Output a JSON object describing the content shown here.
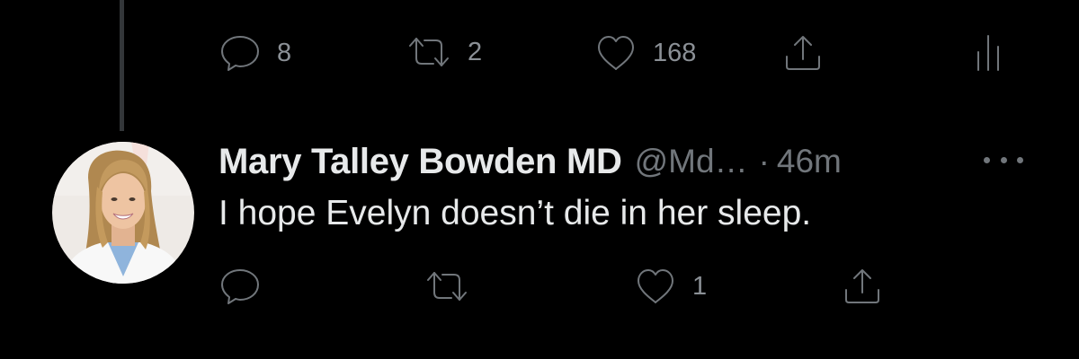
{
  "top_tweet_actions": {
    "reply_count": "8",
    "retweet_count": "2",
    "like_count": "168"
  },
  "reply_tweet": {
    "author": {
      "display_name": "Mary Talley Bowden MD",
      "handle": "@Md…",
      "separator": "·",
      "timestamp": "46m"
    },
    "text": "I hope Evelyn doesn’t die in her sleep.",
    "actions": {
      "reply_count": "",
      "retweet_count": "",
      "like_count": "1"
    }
  },
  "icons": {
    "reply": "speech-bubble",
    "retweet": "retweet-arrows",
    "like": "heart",
    "share": "upload-arrow",
    "analytics": "bar-chart",
    "more": "three-dots"
  },
  "colors": {
    "background": "#000000",
    "primary_text": "#e7e9ea",
    "secondary_text": "#71767b",
    "thread_line": "#333639"
  }
}
